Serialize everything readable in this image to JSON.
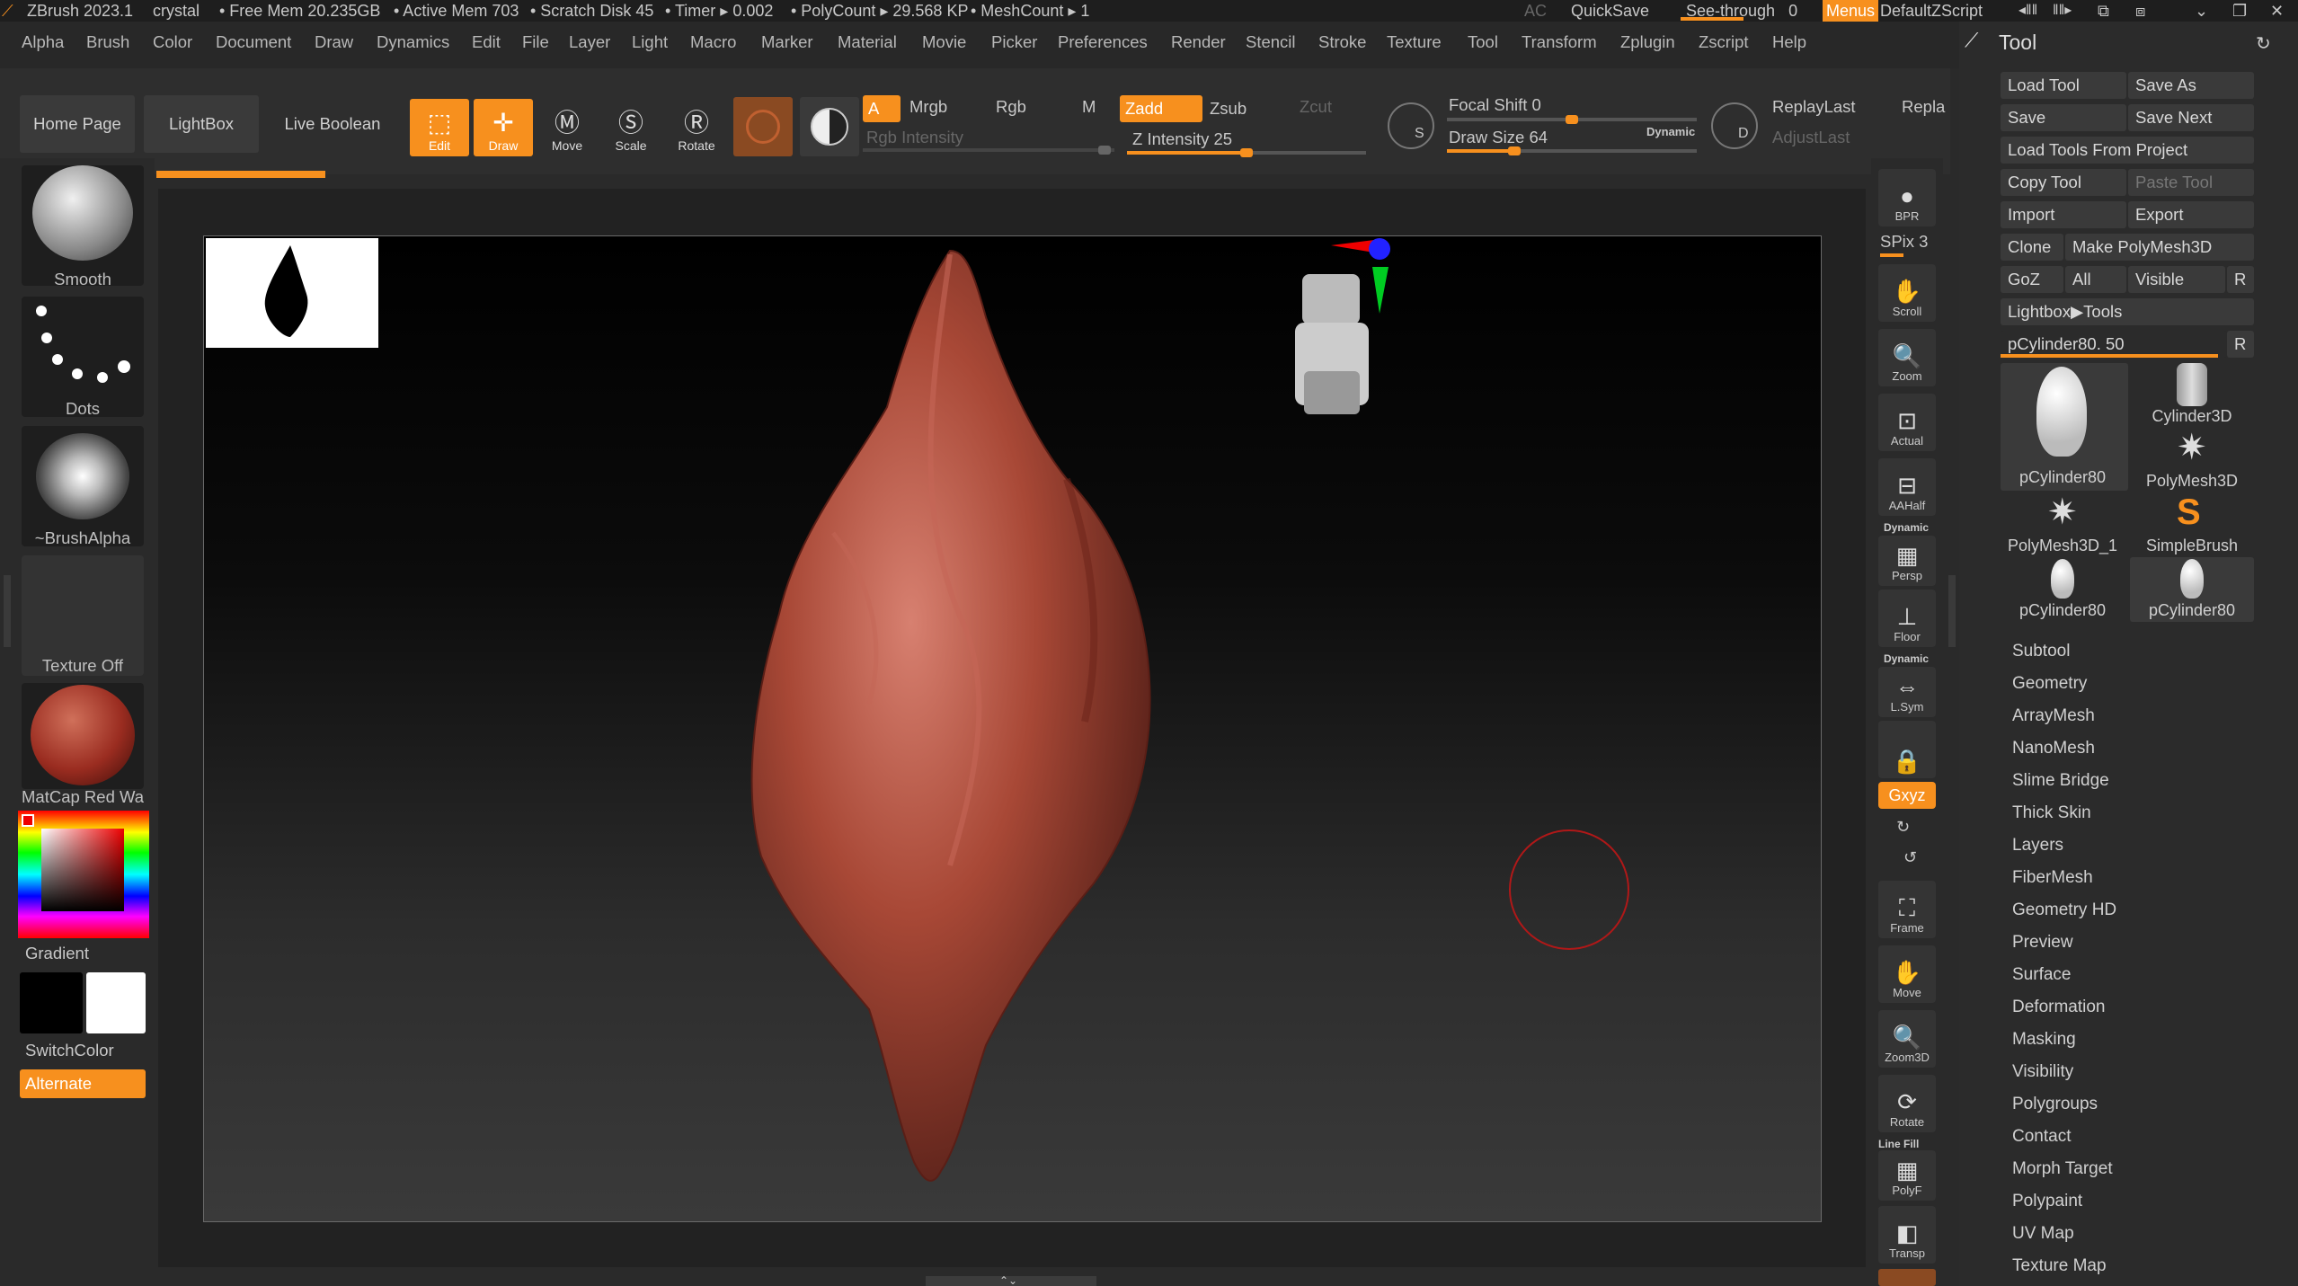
{
  "titlebar": {
    "app": "ZBrush 2023.1",
    "doc": "crystal",
    "free_mem": "• Free Mem 20.235GB",
    "active_mem": "• Active Mem 703",
    "scratch": "• Scratch Disk 45",
    "timer": "• Timer ▸ 0.002",
    "polycount": "• PolyCount ▸ 29.568 KP",
    "meshcount": "• MeshCount ▸ 1",
    "ac": "AC",
    "quicksave": "QuickSave",
    "seethrough": "See-through",
    "seethrough_value": "0",
    "menus": "Menus",
    "zscript": "DefaultZScript"
  },
  "menus": [
    "Alpha",
    "Brush",
    "Color",
    "Document",
    "Draw",
    "Dynamics",
    "Edit",
    "File",
    "Layer",
    "Light",
    "Macro",
    "Marker",
    "Material",
    "Movie",
    "Picker",
    "Preferences",
    "Render",
    "Stencil",
    "Stroke",
    "Texture",
    "Tool",
    "Transform",
    "Zplugin",
    "Zscript",
    "Help"
  ],
  "toolbar": {
    "home_page": "Home Page",
    "lightbox": "LightBox",
    "live_boolean": "Live Boolean",
    "edit": "Edit",
    "draw": "Draw",
    "move": "Move",
    "scale": "Scale",
    "rotate": "Rotate",
    "a": "A",
    "mrgb": "Mrgb",
    "rgb": "Rgb",
    "m": "M",
    "zadd": "Zadd",
    "zsub": "Zsub",
    "zcut": "Zcut",
    "rgb_intensity": "Rgb Intensity",
    "z_intensity": "Z Intensity 25",
    "focal_shift": "Focal Shift 0",
    "draw_size": "Draw Size 64",
    "dynamic": "Dynamic",
    "replay_last": "ReplayLast",
    "repla": "Repla",
    "adjust_last": "AdjustLast",
    "focal_shift_value": 0,
    "draw_size_value": 64,
    "z_intensity_value": 25
  },
  "left_shelf": {
    "brush": "Smooth",
    "stroke": "Dots",
    "alpha": "~BrushAlpha",
    "texture": "Texture Off",
    "material": "MatCap Red Wax",
    "gradient": "Gradient",
    "switchcolor": "SwitchColor",
    "alternate": "Alternate"
  },
  "right_shelf": {
    "bpr": "BPR",
    "spix": "SPix 3",
    "scroll": "Scroll",
    "zoom": "Zoom",
    "actual": "Actual",
    "aahalf": "AAHalf",
    "dynamic": "Dynamic",
    "persp": "Persp",
    "floor": "Floor",
    "lsym": "L.Sym",
    "xyz": "Gxyz",
    "frame": "Frame",
    "move": "Move",
    "zoom3d": "Zoom3D",
    "rotate": "Rotate",
    "linefill": "Line Fill",
    "polyf": "PolyF",
    "transp": "Transp"
  },
  "tool_panel": {
    "title": "Tool",
    "load_tool": "Load Tool",
    "save_as": "Save As",
    "save": "Save",
    "save_next": "Save Next",
    "load_tools_from_project": "Load Tools From Project",
    "copy_tool": "Copy Tool",
    "paste_tool": "Paste Tool",
    "import": "Import",
    "export": "Export",
    "clone": "Clone",
    "make_polymesh": "Make PolyMesh3D",
    "goz": "GoZ",
    "all": "All",
    "visible": "Visible",
    "r": "R",
    "lightbox_tools": "Lightbox▶Tools",
    "current_tool": "pCylinder80. 50",
    "current_tool_value": 50,
    "subtools": [
      "pCylinder80",
      "Cylinder3D",
      "PolyMesh3D",
      "PolyMesh3D_1",
      "SimpleBrush",
      "pCylinder80",
      "pCylinder80"
    ],
    "subpalettes": [
      "Subtool",
      "Geometry",
      "ArrayMesh",
      "NanoMesh",
      "Slime Bridge",
      "Thick Skin",
      "Layers",
      "FiberMesh",
      "Geometry HD",
      "Preview",
      "Surface",
      "Deformation",
      "Masking",
      "Visibility",
      "Polygroups",
      "Contact",
      "Morph Target",
      "Polypaint",
      "UV Map",
      "Texture Map"
    ]
  },
  "colors": {
    "accent": "#f7901e",
    "model": "#b5483a"
  }
}
